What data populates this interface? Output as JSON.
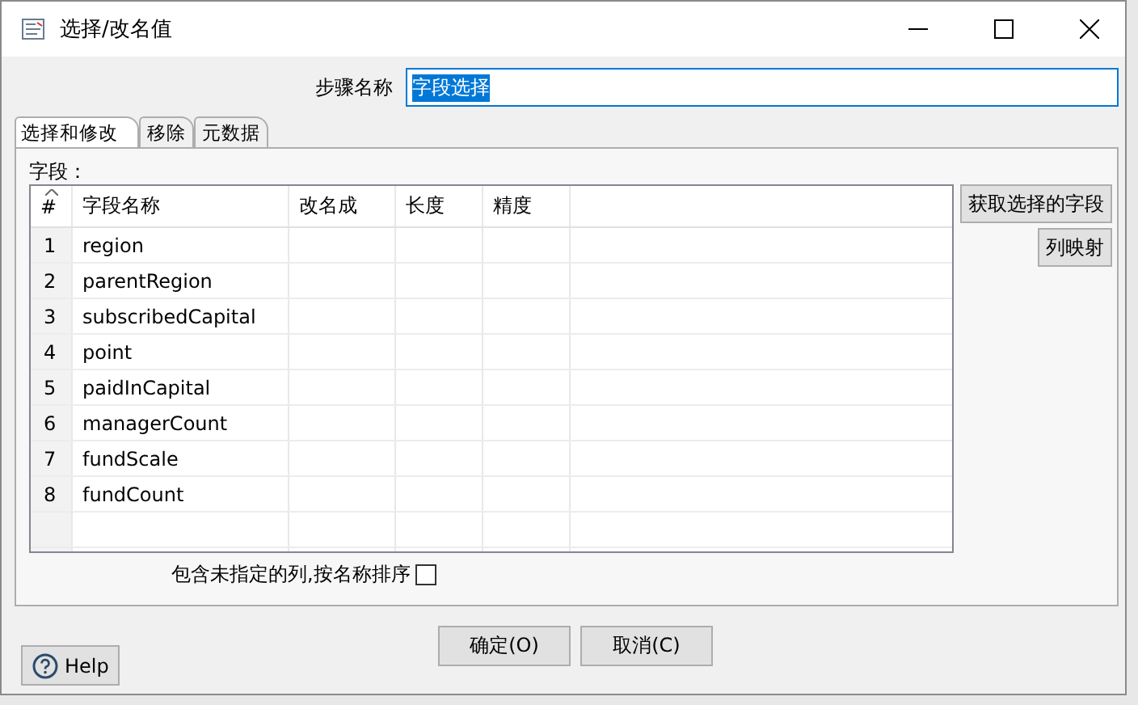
{
  "window": {
    "title": "选择/改名值"
  },
  "step_name": {
    "label": "步骤名称",
    "value": "字段选择",
    "value_selected": true
  },
  "tabs": [
    {
      "label": "选择和修改",
      "selected": true
    },
    {
      "label": "移除",
      "selected": false
    },
    {
      "label": "元数据",
      "selected": false
    }
  ],
  "fields_label": "字段：",
  "table": {
    "columns": [
      "#",
      "字段名称",
      "改名成",
      "长度",
      "精度"
    ],
    "rows": [
      {
        "index": "1",
        "name": "region"
      },
      {
        "index": "2",
        "name": "parentRegion"
      },
      {
        "index": "3",
        "name": "subscribedCapital"
      },
      {
        "index": "4",
        "name": "point"
      },
      {
        "index": "5",
        "name": "paidInCapital"
      },
      {
        "index": "6",
        "name": "managerCount"
      },
      {
        "index": "7",
        "name": "fundScale"
      },
      {
        "index": "8",
        "name": "fundCount"
      }
    ]
  },
  "side_buttons": [
    "获取选择的字段",
    "列映射"
  ],
  "include_unspecified": {
    "label": "包含未指定的列,按名称排序",
    "checked": false
  },
  "buttons": [
    "确定(O)",
    "取消(C)"
  ],
  "help_button": "Help"
}
